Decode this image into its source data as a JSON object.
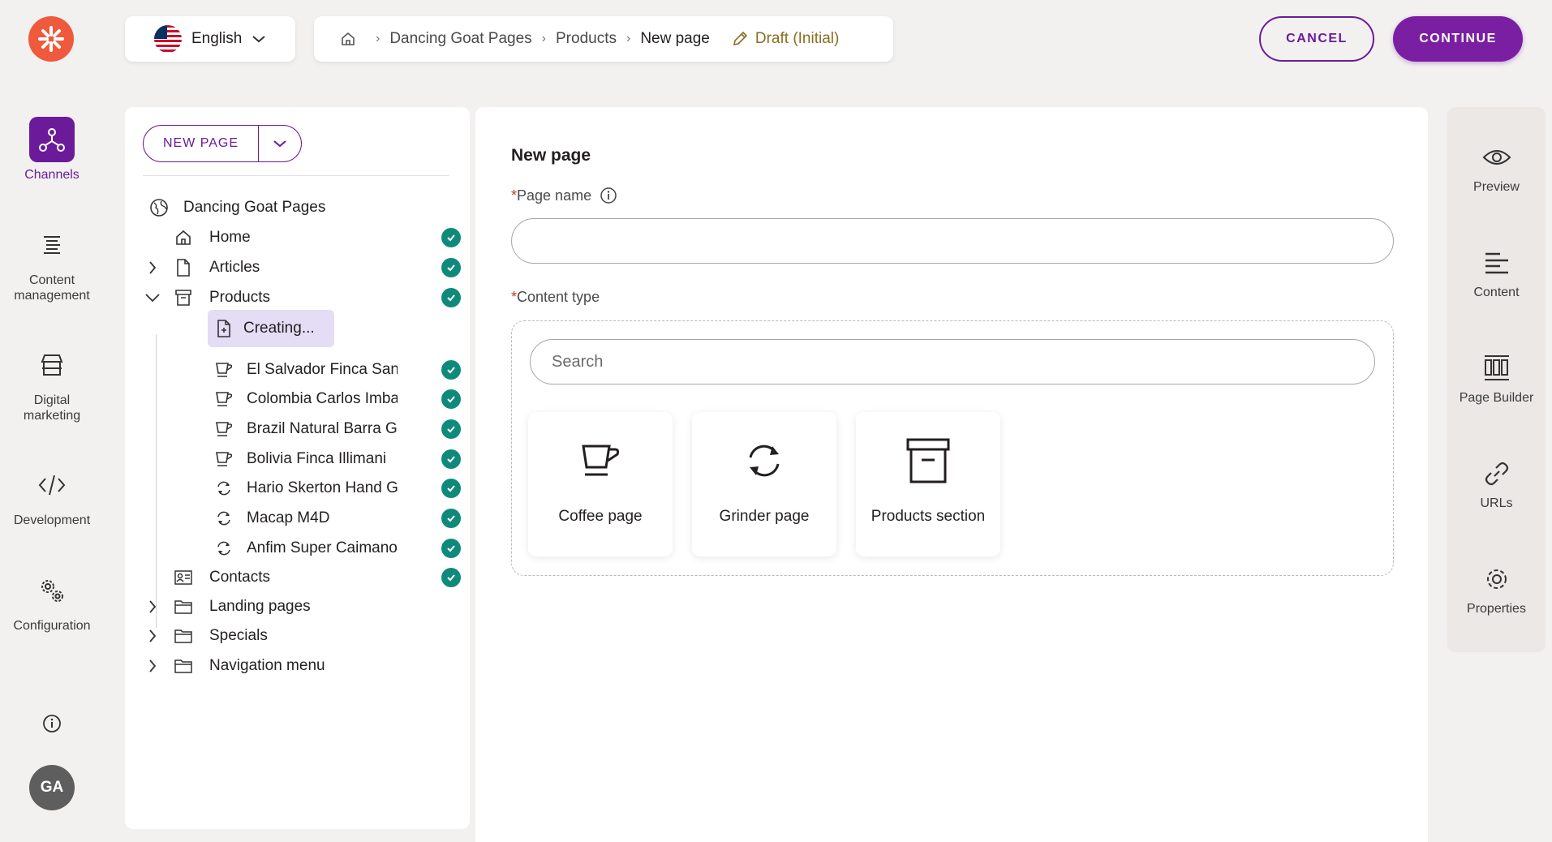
{
  "topbar": {
    "language": "English",
    "breadcrumb": {
      "items": [
        "Dancing Goat Pages",
        "Products"
      ],
      "current": "New page",
      "status": "Draft (Initial)"
    },
    "cancel_label": "CANCEL",
    "continue_label": "CONTINUE"
  },
  "leftnav": {
    "items": [
      {
        "label": "Channels",
        "icon": "channels-icon",
        "active": true
      },
      {
        "label": "Content management",
        "icon": "content-management-icon"
      },
      {
        "label": "Digital marketing",
        "icon": "digital-marketing-icon"
      },
      {
        "label": "Development",
        "icon": "code-icon"
      },
      {
        "label": "Configuration",
        "icon": "gears-icon"
      }
    ],
    "avatar_initials": "GA"
  },
  "tree": {
    "new_page_label": "NEW PAGE",
    "root": "Dancing Goat Pages",
    "nodes": [
      {
        "label": "Home",
        "icon": "home-icon",
        "published": true
      },
      {
        "label": "Articles",
        "icon": "file-icon",
        "published": true,
        "expandable": true
      },
      {
        "label": "Products",
        "icon": "archive-icon",
        "published": true,
        "expanded": true
      },
      {
        "label": "Creating...",
        "icon": "new-file-icon",
        "selected": true
      },
      {
        "label": "El Salvador Finca San José",
        "icon": "cup-icon",
        "published": true
      },
      {
        "label": "Colombia Carlos Imbachi",
        "icon": "cup-icon",
        "published": true
      },
      {
        "label": "Brazil Natural Barra Grande",
        "icon": "cup-icon",
        "published": true
      },
      {
        "label": "Bolivia Finca Illimani",
        "icon": "cup-icon",
        "published": true
      },
      {
        "label": "Hario Skerton Hand Grinder",
        "icon": "grinder-icon",
        "published": true
      },
      {
        "label": "Macap M4D",
        "icon": "grinder-icon",
        "published": true
      },
      {
        "label": "Anfim Super Caimano",
        "icon": "grinder-icon",
        "published": true
      },
      {
        "label": "Contacts",
        "icon": "contacts-icon",
        "published": true
      },
      {
        "label": "Landing pages",
        "icon": "folder-icon",
        "expandable": true
      },
      {
        "label": "Specials",
        "icon": "folder-icon",
        "expandable": true
      },
      {
        "label": "Navigation menu",
        "icon": "folder-icon",
        "expandable": true
      }
    ]
  },
  "form": {
    "title": "New page",
    "page_name_label": "Page name",
    "page_name_value": "",
    "content_type_label": "Content type",
    "required_marker": "*",
    "search_placeholder": "Search",
    "content_types": [
      {
        "label": "Coffee page",
        "icon": "cup-icon"
      },
      {
        "label": "Grinder page",
        "icon": "grinder-icon"
      },
      {
        "label": "Products section",
        "icon": "archive-icon"
      }
    ]
  },
  "rightrail": {
    "items": [
      {
        "label": "Preview",
        "icon": "eye-icon"
      },
      {
        "label": "Content",
        "icon": "content-lines-icon"
      },
      {
        "label": "Page Builder",
        "icon": "page-builder-icon"
      },
      {
        "label": "URLs",
        "icon": "link-icon"
      },
      {
        "label": "Properties",
        "icon": "gear-icon"
      }
    ]
  },
  "colors": {
    "accent": "#6b1b9a",
    "continue_bg": "#7b1fa2",
    "logo": "#ef5a3c",
    "published_check": "#0f8a7a",
    "selected_row": "#e5dcf5",
    "draft_text": "#8a6d1e"
  }
}
